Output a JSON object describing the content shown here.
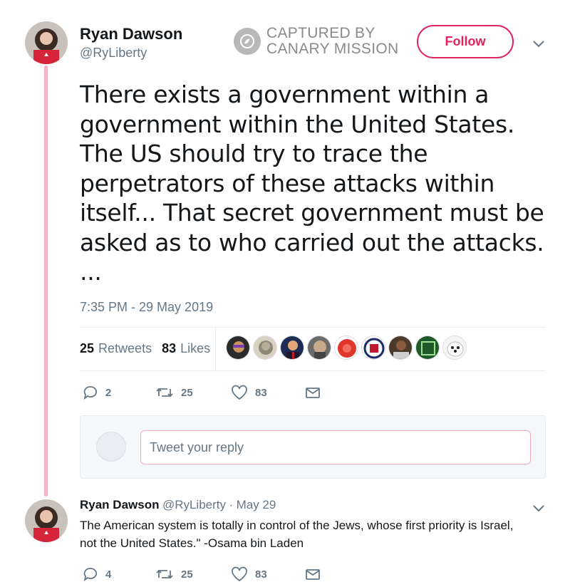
{
  "tweet": {
    "author_name": "Ryan Dawson",
    "author_handle": "@RyLiberty",
    "follow_label": "Follow",
    "text": "There exists a government within a\ngovernment within the United States.\nThe US should try  to trace the\nperpetrators of these attacks within\nitself... That secret government must be\nasked as to who carried out  the attacks.\n...",
    "timestamp": "7:35 PM - 29 May 2019",
    "retweets_count": "25",
    "retweets_label": "Retweets",
    "likes_count": "83",
    "likes_label": "Likes",
    "actions": {
      "reply_count": "2",
      "retweet_count": "25",
      "like_count": "83"
    }
  },
  "watermark": {
    "line1": "CAPTURED BY",
    "line2": "CANARY MISSION"
  },
  "reply_box": {
    "placeholder": "Tweet your reply"
  },
  "reply_tweet": {
    "author_name": "Ryan Dawson",
    "author_handle": "@RyLiberty",
    "separator": "·",
    "date": "May 29",
    "text": "The American system is totally in control of the Jews, whose first priority is Israel,\nnot  the United States.\" -Osama bin Laden",
    "actions": {
      "reply_count": "4",
      "retweet_count": "25",
      "like_count": "83"
    }
  },
  "colors": {
    "accent": "#e0245e",
    "thread_line": "#f4b4c6",
    "muted": "#657786",
    "link": "#1da1f2"
  },
  "icons": [
    "reply-icon",
    "retweet-icon",
    "like-icon",
    "message-icon",
    "chevron-down-icon",
    "canary-logo-icon"
  ]
}
